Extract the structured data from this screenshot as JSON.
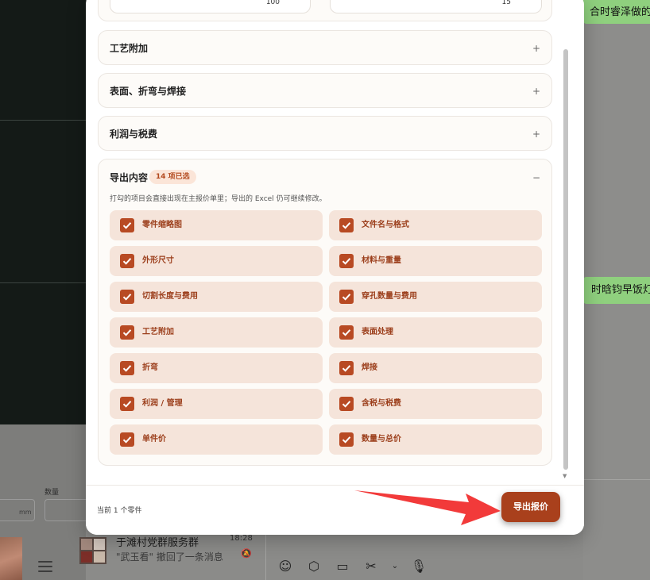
{
  "background": {
    "left_panel": {
      "qty_label": "数量",
      "unit": "mm"
    },
    "chat_bubbles": [
      "合时睿泽做的饭",
      "时晗钧早饭灯"
    ],
    "chat_item": {
      "name": "于滩村党群服务群",
      "time": "18:28",
      "preview": "\"武玉看\" 撤回了一条消息"
    }
  },
  "modal": {
    "top_inputs": [
      {
        "value": "100",
        "unit": "%"
      },
      {
        "value": "15",
        "unit": "%"
      }
    ],
    "sections": [
      {
        "title": "工艺附加",
        "toggle": "+"
      },
      {
        "title": "表面、折弯与焊接",
        "toggle": "+"
      },
      {
        "title": "利润与税费",
        "toggle": "+"
      }
    ],
    "export": {
      "title": "导出内容",
      "badge": "14 项已选",
      "toggle": "−",
      "hint": "打勾的项目会直接出现在主报价单里；导出的 Excel 仍可继续修改。",
      "options": [
        {
          "label": "零件缩略图",
          "checked": true
        },
        {
          "label": "文件名与格式",
          "checked": true
        },
        {
          "label": "外形尺寸",
          "checked": true
        },
        {
          "label": "材料与重量",
          "checked": true
        },
        {
          "label": "切割长度与费用",
          "checked": true
        },
        {
          "label": "穿孔数量与费用",
          "checked": true
        },
        {
          "label": "工艺附加",
          "checked": true
        },
        {
          "label": "表面处理",
          "checked": true
        },
        {
          "label": "折弯",
          "checked": true
        },
        {
          "label": "焊接",
          "checked": true
        },
        {
          "label": "利润 / 管理",
          "checked": true
        },
        {
          "label": "含税与税费",
          "checked": true
        },
        {
          "label": "单件价",
          "checked": true
        },
        {
          "label": "数量与总价",
          "checked": true
        }
      ]
    },
    "footer": {
      "status": "当前 1 个零件",
      "export_button": "导出报价"
    }
  },
  "colors": {
    "accent": "#a9401c",
    "option_bg": "#f5e4da",
    "annotation_arrow": "#f23a3a",
    "chat_bubble": "#8fd07e"
  }
}
